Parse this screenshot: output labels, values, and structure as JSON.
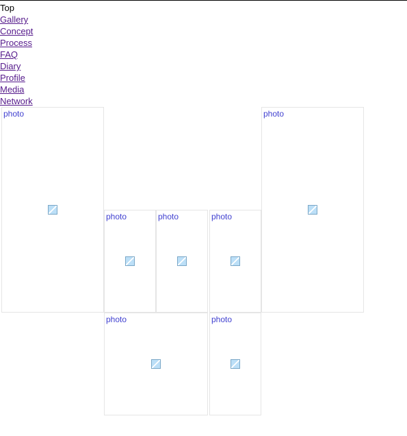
{
  "nav": {
    "top_label": "Top",
    "links": [
      "Gallery",
      "Concept",
      "Process",
      "FAQ",
      "Diary",
      "Profile",
      "Media",
      "Network"
    ]
  },
  "gallery": {
    "caption": "photo",
    "tiles": [
      "t1",
      "t2",
      "t3",
      "t4",
      "t5",
      "t6",
      "t7"
    ]
  }
}
